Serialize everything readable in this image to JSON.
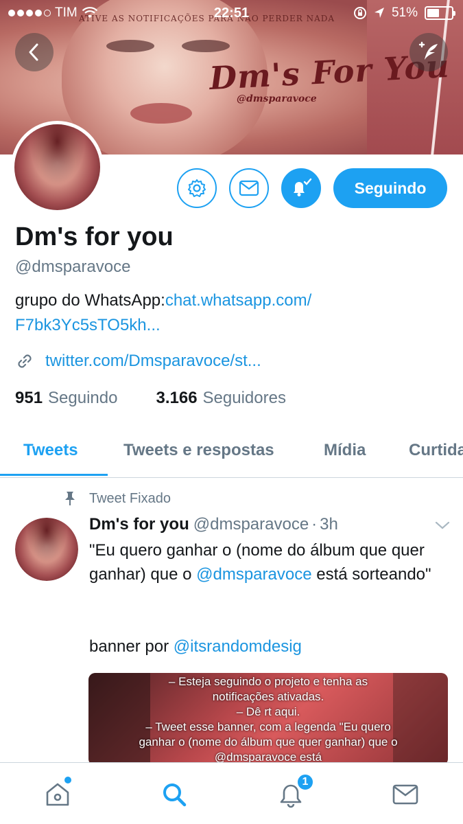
{
  "status_bar": {
    "carrier": "TIM",
    "time": "22:51",
    "battery": "51%",
    "battery_level": 0.51
  },
  "header": {
    "banner_logo": "Dm's For You",
    "banner_handle": "@dmsparavoce",
    "banner_strip_text": "Ative as notificações para não perder nada"
  },
  "profile": {
    "follow_label": "Seguindo",
    "name": "Dm's for you",
    "handle": "@dmsparavoce",
    "bio_prefix": "grupo do WhatsApp:",
    "bio_link_line1": "chat.whatsapp.com/",
    "bio_link_line2": "F7bk3Yc5sTO5kh...",
    "website": "twitter.com/Dmsparavoce/st...",
    "following_count": "951",
    "following_label": "Seguindo",
    "followers_count": "3.166",
    "followers_label": "Seguidores"
  },
  "tabs": [
    {
      "label": "Tweets"
    },
    {
      "label": "Tweets e respostas"
    },
    {
      "label": "Mídia"
    },
    {
      "label": "Curtidas"
    }
  ],
  "tweet": {
    "pinned_label": "Tweet Fixado",
    "author_name": "Dm's for you",
    "author_handle": "@dmsparavoce",
    "separator": "·",
    "time": "3h",
    "text_line1": "\"Eu quero ganhar o (nome do álbum que quer ganhar) que o ",
    "mention1": "@dmsparavoce",
    "text_line1_end": " está sorteando\"",
    "text_banner_prefix": "banner por ",
    "mention2": "@itsrandomdesig",
    "media_text": [
      "– Esteja seguindo o projeto e tenha as",
      "notificações ativadas.",
      "– Dê rt aqui.",
      "– Tweet esse banner, com a legenda \"Eu quero",
      "ganhar o (nome do álbum que quer ganhar) que o",
      "@dmsparavoce está"
    ]
  },
  "bottom_nav": {
    "notifications_badge": "1"
  },
  "colors": {
    "accent": "#1da1f2",
    "link": "#1b95e0",
    "text": "#14171a",
    "muted": "#657786"
  }
}
